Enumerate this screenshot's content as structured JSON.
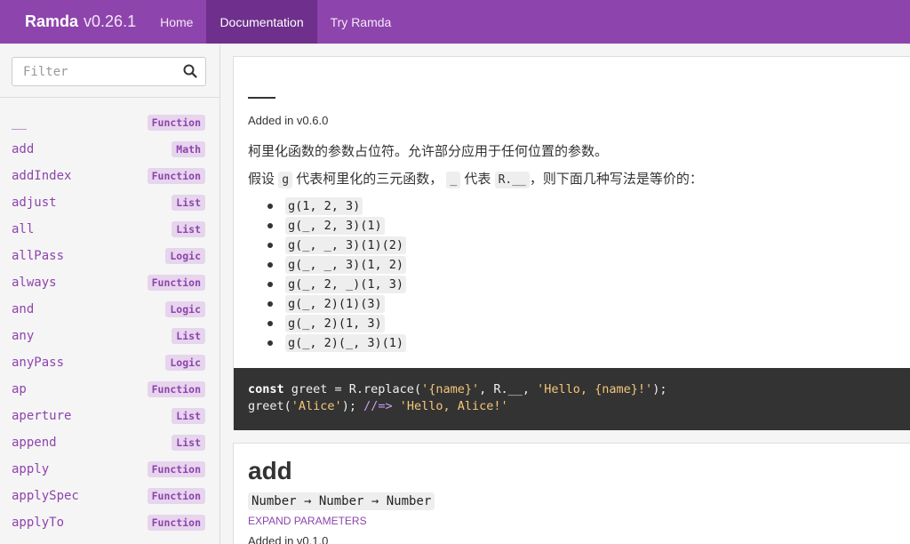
{
  "navbar": {
    "brand_name": "Ramda",
    "brand_version": "v0.26.1",
    "links": [
      {
        "label": "Home"
      },
      {
        "label": "Documentation"
      },
      {
        "label": "Try Ramda"
      }
    ],
    "active": "Documentation"
  },
  "sidebar": {
    "filter_placeholder": "Filter",
    "search_icon": "search-icon",
    "items": [
      {
        "name": "__",
        "category": "Function"
      },
      {
        "name": "add",
        "category": "Math"
      },
      {
        "name": "addIndex",
        "category": "Function"
      },
      {
        "name": "adjust",
        "category": "List"
      },
      {
        "name": "all",
        "category": "List"
      },
      {
        "name": "allPass",
        "category": "Logic"
      },
      {
        "name": "always",
        "category": "Function"
      },
      {
        "name": "and",
        "category": "Logic"
      },
      {
        "name": "any",
        "category": "List"
      },
      {
        "name": "anyPass",
        "category": "Logic"
      },
      {
        "name": "ap",
        "category": "Function"
      },
      {
        "name": "aperture",
        "category": "List"
      },
      {
        "name": "append",
        "category": "List"
      },
      {
        "name": "apply",
        "category": "Function"
      },
      {
        "name": "applySpec",
        "category": "Function"
      },
      {
        "name": "applyTo",
        "category": "Function"
      }
    ]
  },
  "entry_placeholder": {
    "added": "Added in v0.6.0",
    "description": "柯里化函数的参数占位符。允许部分应用于任何位置的参数。",
    "desc2_a": "假设",
    "desc2_g": "g",
    "desc2_b": "代表柯里化的三元函数，",
    "desc2_underscore": "_",
    "desc2_c": "代表",
    "desc2_placeholder": "R.__",
    "desc2_d": "，则下面几种写法是等价的：",
    "examples": [
      "g(1, 2, 3)",
      "g(_, 2, 3)(1)",
      "g(_, _, 3)(1)(2)",
      "g(_, _, 3)(1, 2)",
      "g(_, 2, _)(1, 3)",
      "g(_, 2)(1)(3)",
      "g(_, 2)(1, 3)",
      "g(_, 2)(_, 3)(1)"
    ],
    "code_line1_kw": "const",
    "code_line1_a": " greet = R.replace(",
    "code_line1_s1": "'{name}'",
    "code_line1_b": ", R.__, ",
    "code_line1_s2": "'Hello, {name}!'",
    "code_line1_c": ");",
    "code_line2_a": "greet(",
    "code_line2_s1": "'Alice'",
    "code_line2_b": "); ",
    "code_line2_cmt": "//=>",
    "code_line2_c": " ",
    "code_line2_s2": "'Hello, Alice!'"
  },
  "entry_add": {
    "title": "add",
    "signature": "Number → Number → Number",
    "expand": "EXPAND PARAMETERS",
    "added": "Added in v0.1.0"
  }
}
